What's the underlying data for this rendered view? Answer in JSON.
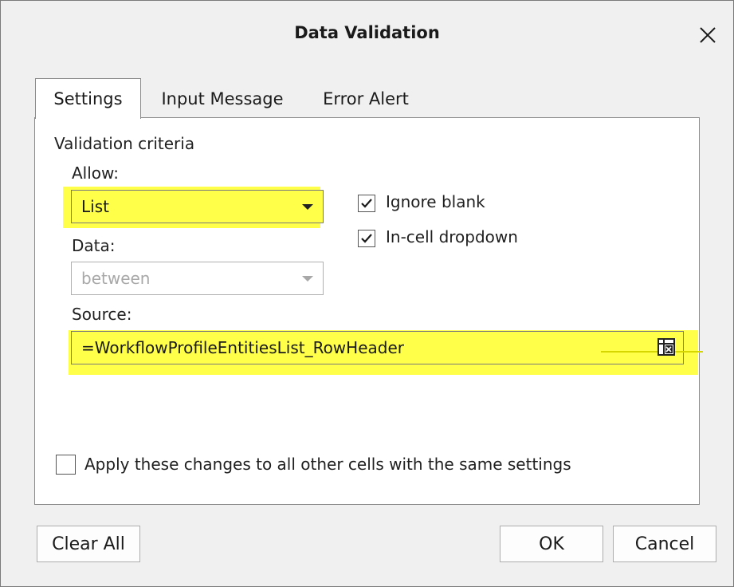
{
  "dialog": {
    "title": "Data Validation"
  },
  "tabs": [
    {
      "label": "Settings",
      "active": true
    },
    {
      "label": "Input Message",
      "active": false
    },
    {
      "label": "Error Alert",
      "active": false
    }
  ],
  "settings": {
    "section_label": "Validation criteria",
    "allow_label": "Allow:",
    "allow_value": "List",
    "data_label": "Data:",
    "data_value": "between",
    "source_label": "Source:",
    "source_value": "=WorkflowProfileEntitiesList_RowHeader",
    "ignore_blank_label": "Ignore blank",
    "ignore_blank_checked": true,
    "in_cell_dropdown_label": "In-cell dropdown",
    "in_cell_dropdown_checked": true,
    "apply_all_label": "Apply these changes to all other cells with the same settings",
    "apply_all_checked": false
  },
  "buttons": {
    "clear_all": "Clear All",
    "ok": "OK",
    "cancel": "Cancel"
  },
  "colors": {
    "highlight": "#ffff4a",
    "dialog_bg": "#f0f0f0",
    "panel_bg": "#ffffff",
    "checkbox_check": "#1a1a1a"
  },
  "icons": {
    "close": "close-icon",
    "dropdown": "chevron-down-icon",
    "range_selector": "range-selector-icon",
    "checkmark": "checkmark-icon"
  }
}
